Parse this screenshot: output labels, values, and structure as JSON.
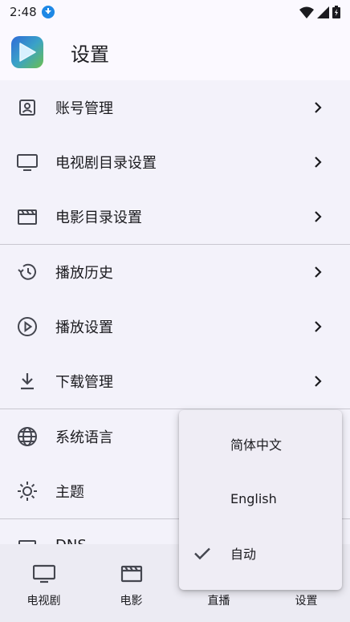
{
  "status_bar": {
    "time": "2:48"
  },
  "header": {
    "title": "设置"
  },
  "settings": {
    "group1": [
      {
        "label": "账号管理",
        "icon": "account-box-icon"
      },
      {
        "label": "电视剧目录设置",
        "icon": "tv-icon"
      },
      {
        "label": "电影目录设置",
        "icon": "movie-icon"
      }
    ],
    "group2": [
      {
        "label": "播放历史",
        "icon": "history-icon"
      },
      {
        "label": "播放设置",
        "icon": "play-circle-icon"
      },
      {
        "label": "下载管理",
        "icon": "download-icon"
      }
    ],
    "group3": [
      {
        "label": "系统语言",
        "icon": "globe-icon"
      },
      {
        "label": "主题",
        "icon": "sun-icon"
      }
    ],
    "group4": [
      {
        "label": "DNS",
        "icon": "dns-icon"
      }
    ]
  },
  "language_menu": {
    "options": [
      "简体中文",
      "English",
      "自动"
    ],
    "selected": "自动"
  },
  "bottom_nav": {
    "items": [
      {
        "label": "电视剧",
        "icon": "tv-icon"
      },
      {
        "label": "电影",
        "icon": "movie-icon"
      },
      {
        "label": "直播",
        "icon": "live-icon"
      },
      {
        "label": "设置",
        "icon": "settings-icon"
      }
    ]
  }
}
